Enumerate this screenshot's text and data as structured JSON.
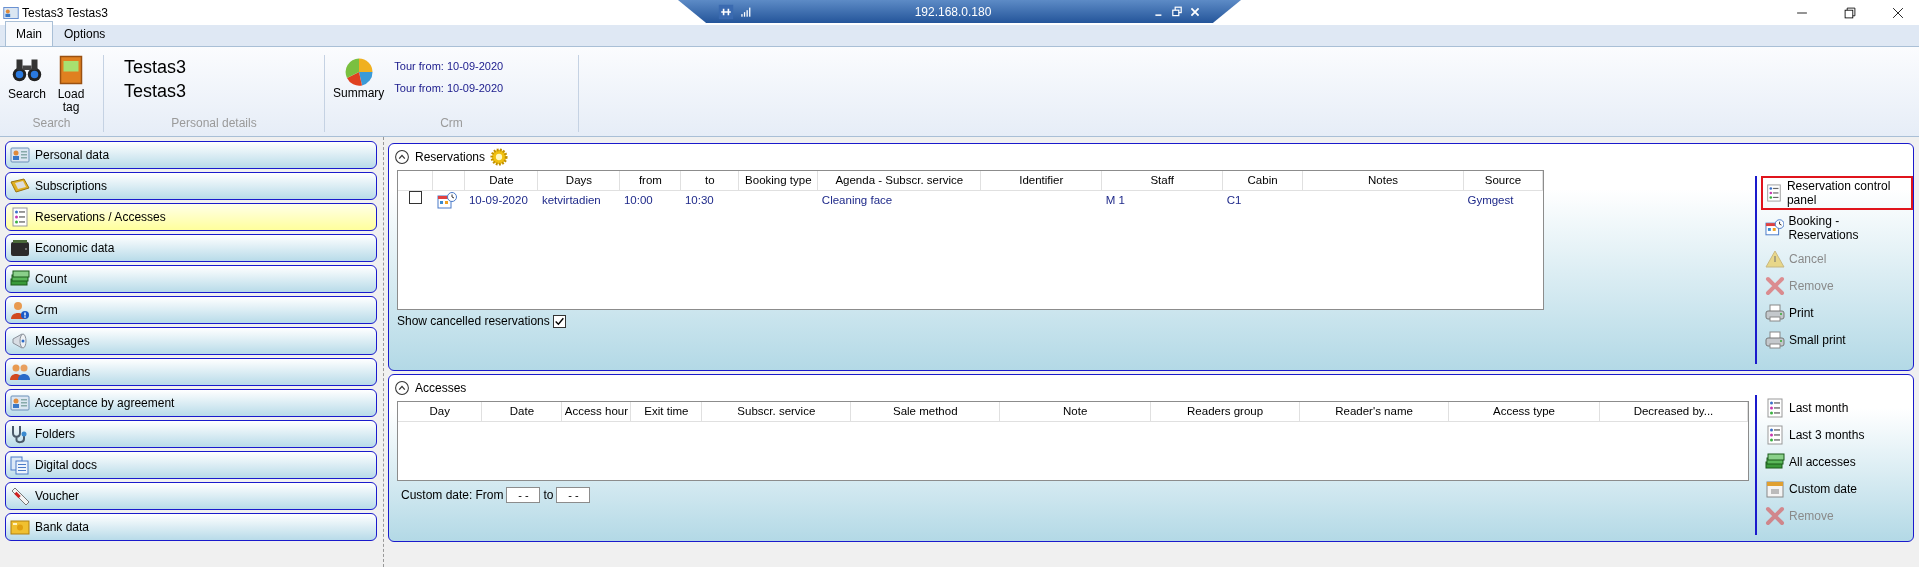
{
  "window": {
    "title": "Testas3 Testas3"
  },
  "remote_bar": {
    "address": "192.168.0.180"
  },
  "ribbon": {
    "tabs": [
      {
        "label": "Main",
        "selected": true
      },
      {
        "label": "Options",
        "selected": false
      }
    ],
    "groups": [
      {
        "kind": "buttons",
        "caption": "Search",
        "buttons": [
          "Search",
          "Load tag"
        ]
      },
      {
        "kind": "names",
        "caption": "Personal details",
        "lines": [
          "Testas3",
          "Testas3"
        ]
      },
      {
        "kind": "crm",
        "caption": "Crm",
        "buttons": [
          "Summary"
        ],
        "links": [
          "Tour from: 10-09-2020",
          "Tour from: 10-09-2020"
        ]
      }
    ]
  },
  "sidebar": {
    "items": [
      {
        "label": "Personal data",
        "selected": false
      },
      {
        "label": "Subscriptions",
        "selected": false
      },
      {
        "label": "Reservations / Accesses",
        "selected": true
      },
      {
        "label": "Economic data",
        "selected": false
      },
      {
        "label": "Count",
        "selected": false
      },
      {
        "label": "Crm",
        "selected": false
      },
      {
        "label": "Messages",
        "selected": false
      },
      {
        "label": "Guardians",
        "selected": false
      },
      {
        "label": "Acceptance by agreement",
        "selected": false
      },
      {
        "label": "Folders",
        "selected": false
      },
      {
        "label": "Digital docs",
        "selected": false
      },
      {
        "label": "Voucher",
        "selected": false
      },
      {
        "label": "Bank data",
        "selected": false
      }
    ]
  },
  "reservations": {
    "title": "Reservations",
    "expanded": true,
    "columns": [
      "Date",
      "Days",
      "from",
      "to",
      "Booking type",
      "Agenda - Subscr. service",
      "Identifier",
      "Staff",
      "Cabin",
      "Notes",
      "Source"
    ],
    "rows": [
      {
        "checked": false,
        "cells": [
          "10-09-2020",
          "ketvirtadien",
          "10:00",
          "10:30",
          null,
          "Cleaning face",
          null,
          "M 1",
          "C1",
          null,
          "Gymgest"
        ]
      }
    ],
    "show_cancelled": {
      "label": "Show cancelled reservations",
      "checked": true
    },
    "actions": [
      {
        "label": "Reservation control panel",
        "disabled": false,
        "highlighted": true
      },
      {
        "label": "Booking - Reservations",
        "disabled": false,
        "highlighted": false
      },
      {
        "label": "Cancel",
        "disabled": true,
        "highlighted": false
      },
      {
        "label": "Remove",
        "disabled": true,
        "highlighted": false
      },
      {
        "label": "Print",
        "disabled": false,
        "highlighted": false
      },
      {
        "label": "Small print",
        "disabled": false,
        "highlighted": false
      }
    ]
  },
  "accesses": {
    "title": "Accesses",
    "expanded": true,
    "columns": [
      "Day",
      "Date",
      "Access hour",
      "Exit time",
      "Subscr. service",
      "Sale method",
      "Note",
      "Readers group",
      "Reader's name",
      "Access type",
      "Decreased by..."
    ],
    "custom_date": {
      "label": "Custom date:",
      "from_label": "From",
      "from_value": "- -",
      "to_label": "to",
      "to_value": "- -"
    },
    "actions": [
      {
        "label": "Last month",
        "disabled": false,
        "highlighted": false
      },
      {
        "label": "Last 3 months",
        "disabled": false,
        "highlighted": false
      },
      {
        "label": "All accesses",
        "disabled": false,
        "highlighted": false
      },
      {
        "label": "Custom date",
        "disabled": false,
        "highlighted": false
      },
      {
        "label": "Remove",
        "disabled": true,
        "highlighted": false
      }
    ]
  }
}
